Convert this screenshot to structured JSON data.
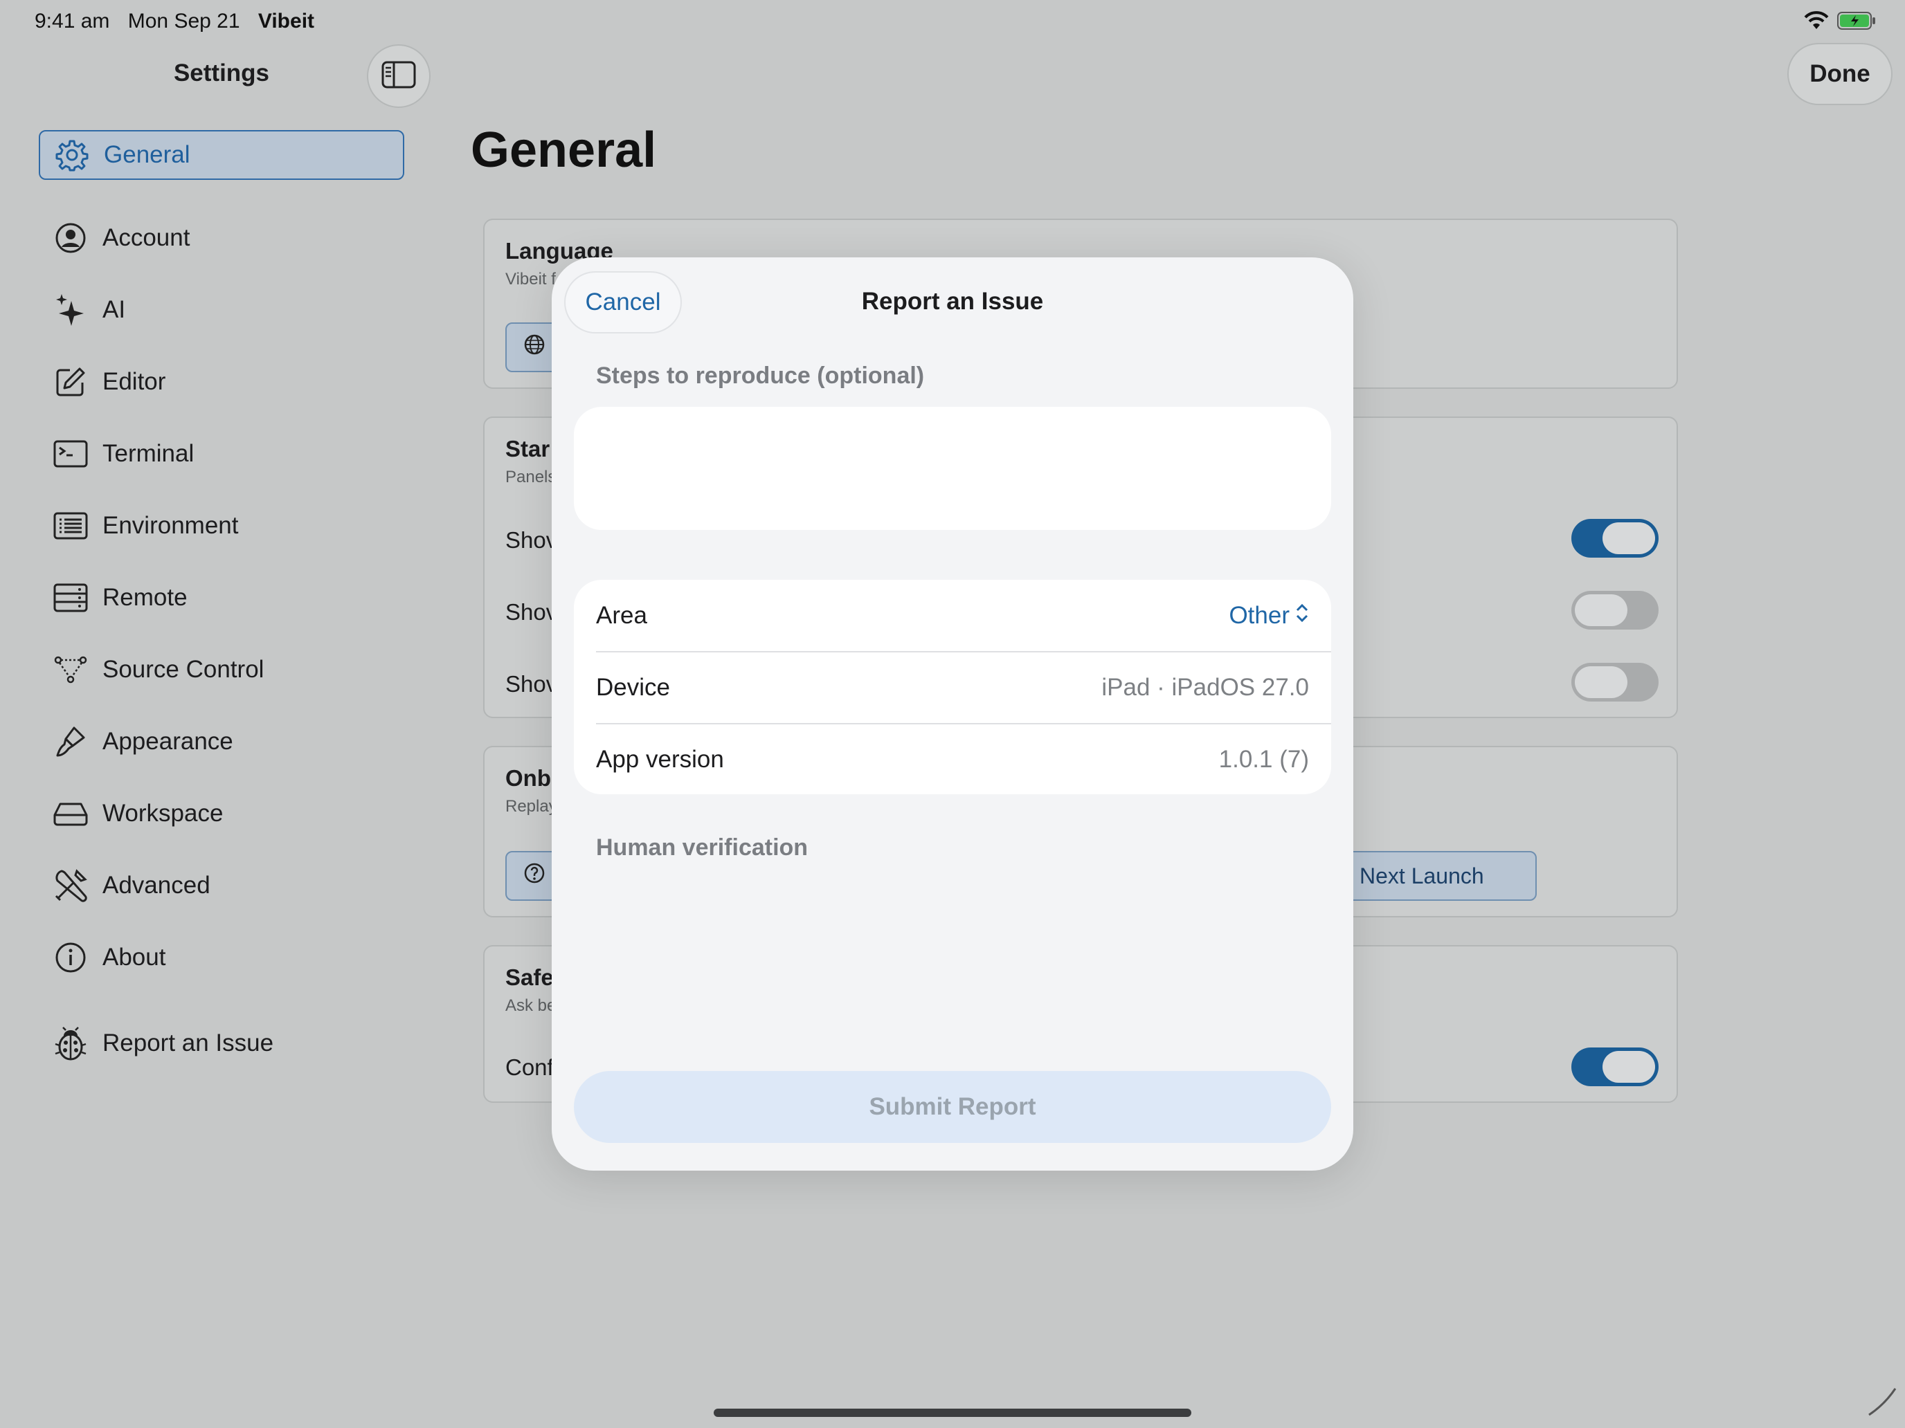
{
  "status_bar": {
    "time": "9:41 am",
    "date": "Mon Sep 21",
    "app": "Vibeit"
  },
  "sidebar": {
    "title": "Settings",
    "items": [
      {
        "label": "General",
        "icon": "gear-icon",
        "selected": true
      },
      {
        "label": "Account",
        "icon": "person-circle-icon"
      },
      {
        "label": "AI",
        "icon": "sparkles-icon"
      },
      {
        "label": "Editor",
        "icon": "square-pencil-icon"
      },
      {
        "label": "Terminal",
        "icon": "terminal-icon"
      },
      {
        "label": "Environment",
        "icon": "list-box-icon"
      },
      {
        "label": "Remote",
        "icon": "server-icon"
      },
      {
        "label": "Source Control",
        "icon": "branch-icon"
      },
      {
        "label": "Appearance",
        "icon": "paintbrush-icon"
      },
      {
        "label": "Workspace",
        "icon": "drive-icon"
      },
      {
        "label": "Advanced",
        "icon": "wrench-screwdriver-icon"
      },
      {
        "label": "About",
        "icon": "info-circle-icon"
      },
      {
        "label": "Report an Issue",
        "icon": "ladybug-icon"
      }
    ]
  },
  "header": {
    "done_label": "Done"
  },
  "main": {
    "title": "General",
    "language": {
      "title": "Language",
      "sub": "Vibeit f"
    },
    "startup": {
      "title": "Star",
      "sub": "Panels",
      "rows": [
        "Shov",
        "Shov",
        "Shov"
      ],
      "toggles": [
        true,
        false,
        false
      ]
    },
    "onboarding": {
      "title": "Onb",
      "sub": "Replay",
      "button_label": "Next Launch"
    },
    "safety": {
      "title": "Safe",
      "sub": "Ask be",
      "row": "Conf",
      "toggle": true
    }
  },
  "modal": {
    "cancel_label": "Cancel",
    "title": "Report an Issue",
    "steps_label": "Steps to reproduce (optional)",
    "area": {
      "label": "Area",
      "value": "Other"
    },
    "device": {
      "label": "Device",
      "value": "iPad · iPadOS 27.0"
    },
    "app_version": {
      "label": "App version",
      "value": "1.0.1 (7)"
    },
    "human_verification_label": "Human verification",
    "submit_label": "Submit Report"
  },
  "colors": {
    "accent": "#1f66a6",
    "toggle_on": "#1a5c94",
    "submit_disabled_bg": "#dde8f7"
  }
}
